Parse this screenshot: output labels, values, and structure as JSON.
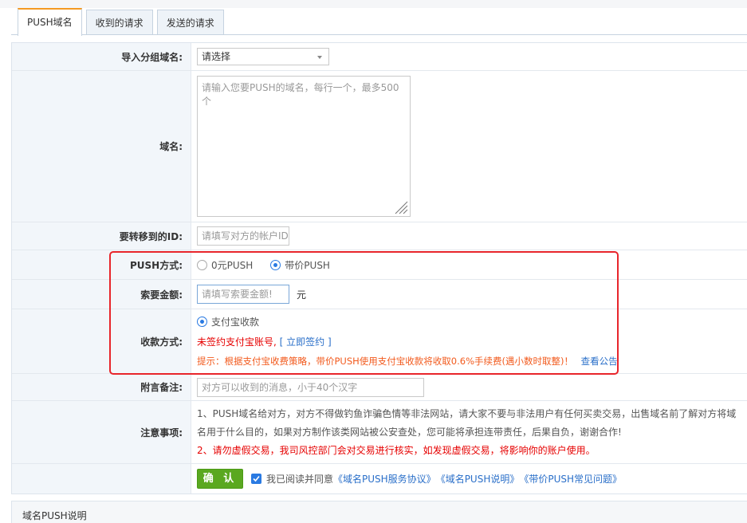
{
  "tabs": [
    {
      "label": "PUSH域名",
      "active": true
    },
    {
      "label": "收到的请求",
      "active": false
    },
    {
      "label": "发送的请求",
      "active": false
    }
  ],
  "form": {
    "group_label": "导入分组域名:",
    "group_select": "请选择",
    "domain_label": "域名:",
    "domain_placeholder": "请输入您要PUSH的域名，每行一个，最多500个",
    "target_label": "要转移到的ID:",
    "target_placeholder": "请填写对方的帐户ID",
    "method_label": "PUSH方式:",
    "method_options": [
      {
        "label": "0元PUSH",
        "selected": false
      },
      {
        "label": "带价PUSH",
        "selected": true
      }
    ],
    "amount_label": "索要金额:",
    "amount_placeholder": "请填写索要金额!",
    "amount_unit": "元",
    "payment_label": "收款方式:",
    "payment_option": "支付宝收款",
    "unsigned_text": "未签约支付宝账号,",
    "sign_link": "[ 立即签约 ]",
    "tip_text": "提示：根据支付宝收费策略，带价PUSH使用支付宝收款将收取0.6%手续费(遇小数时取整)！",
    "tip_link": "查看公告",
    "remark_label": "附言备注:",
    "remark_placeholder": "对方可以收到的消息，小于40个汉字",
    "notes_label": "注意事项:",
    "note1": "1、PUSH域名给对方，对方不得做钓鱼诈骗色情等非法网站，请大家不要与非法用户有任何买卖交易，出售域名前了解对方将域名用于什么目的，如果对方制作该类网站被公安查处，您可能将承担连带责任，后果自负，谢谢合作!",
    "note2": "2、请勿虚假交易，我司风控部门会对交易进行核实，如发现虚假交易，将影响你的账户使用。",
    "confirm_button": "确 认",
    "agree_text": "我已阅读并同意",
    "agreements": [
      "《域名PUSH服务协议》",
      "《域名PUSH说明》",
      "《带价PUSH常见问题》"
    ]
  },
  "bottom_panel": {
    "title": "域名PUSH说明"
  },
  "colors": {
    "accent": "#2a7ae2",
    "confirm": "#5aa820",
    "warning": "#e60000",
    "tip": "#f25a1d",
    "highlight_box": "#e8252b"
  }
}
